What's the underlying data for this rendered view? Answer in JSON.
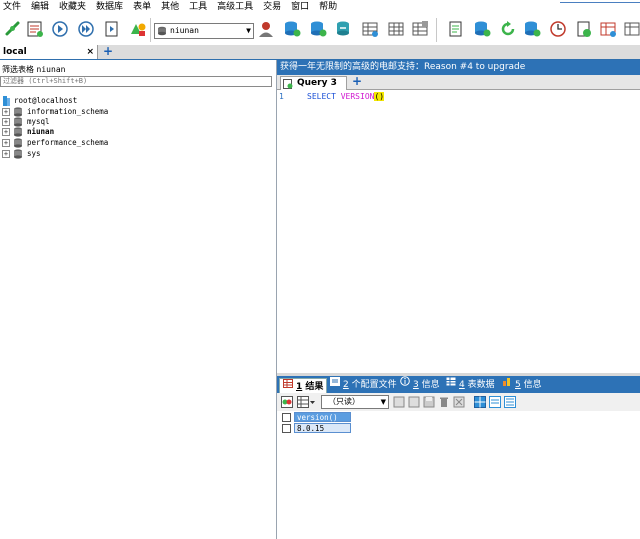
{
  "menu": [
    "文件",
    "编辑",
    "收藏夹",
    "数据库",
    "表单",
    "其他",
    "工具",
    "高级工具",
    "交易",
    "窗口",
    "帮助"
  ],
  "toolbar": {
    "selected_db": "niunan",
    "icons": [
      "new-connection-icon",
      "new-query-icon",
      "execute-icon",
      "execute-all-icon",
      "execute-edit-icon",
      "schema-designer-icon",
      "user-manager-icon",
      "create-database-icon",
      "create-table-icon",
      "alter-table-icon",
      "manage-index-icon",
      "manage-relations-icon",
      "check-table-icon",
      "backup-icon",
      "restore-icon",
      "refresh-icon",
      "import-icon",
      "scheduled-task-icon",
      "create-view-icon",
      "create-trigger-icon",
      "more-icon"
    ]
  },
  "connection": {
    "tab_label": "local",
    "close": "×",
    "add": "+"
  },
  "filter": {
    "label": "筛选表格",
    "db": "niunan",
    "placeholder": "过滤器 (Ctrl+Shift+B)"
  },
  "tree": {
    "root": "root@localhost",
    "databases": [
      {
        "name": "information_schema",
        "bold": false
      },
      {
        "name": "mysql",
        "bold": false
      },
      {
        "name": "niunan",
        "bold": true
      },
      {
        "name": "performance_schema",
        "bold": false
      },
      {
        "name": "sys",
        "bold": false
      }
    ]
  },
  "banner": "获得一年无限制的高级的电邮支持：Reason #4 to upgrade",
  "query_tab": {
    "label": "Query 3",
    "add": "+"
  },
  "editor": {
    "line": "1",
    "kw": "SELECT",
    "fn": "VERSION",
    "paren": "()"
  },
  "result_tabs": [
    {
      "num": "1",
      "label": "结果",
      "active": true
    },
    {
      "num": "2",
      "label": "个配置文件",
      "active": false
    },
    {
      "num": "3",
      "label": "信息",
      "active": false
    },
    {
      "num": "4",
      "label": "表数据",
      "active": false
    },
    {
      "num": "5",
      "label": "信息",
      "active": false
    }
  ],
  "result_toolbar": {
    "readonly": "（只读）"
  },
  "grid": {
    "header": "version()",
    "value": "8.0.15"
  }
}
